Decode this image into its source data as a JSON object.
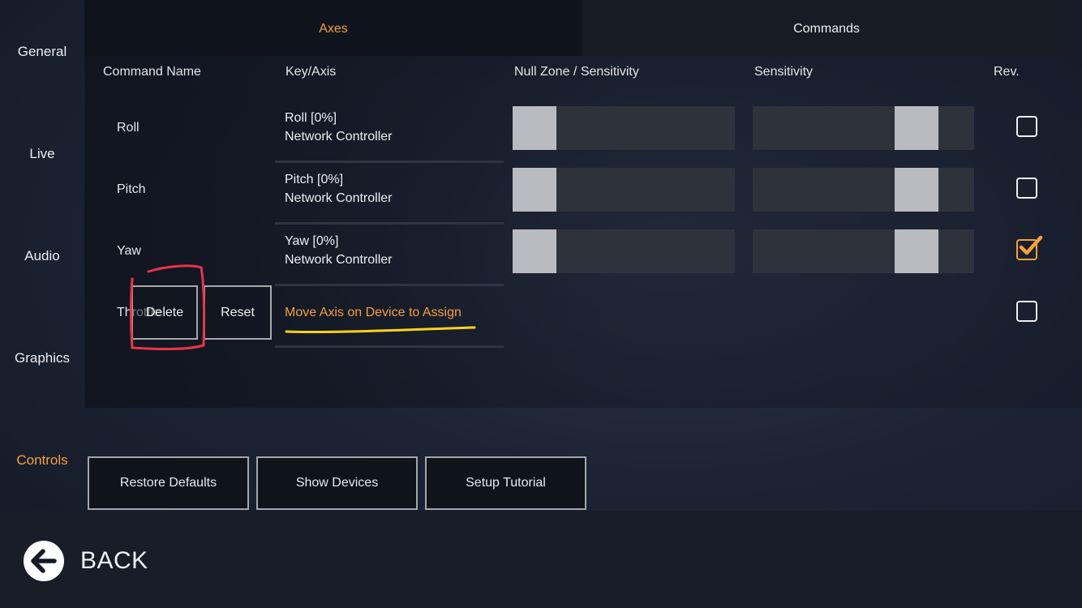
{
  "sidebar": {
    "items": [
      {
        "label": "General",
        "active": false
      },
      {
        "label": "Live",
        "active": false
      },
      {
        "label": "Audio",
        "active": false
      },
      {
        "label": "Graphics",
        "active": false
      },
      {
        "label": "Controls",
        "active": true
      }
    ]
  },
  "tabs": [
    {
      "label": "Axes",
      "active": true
    },
    {
      "label": "Commands",
      "active": false
    }
  ],
  "columns": [
    "Command Name",
    "Key/Axis",
    "Null Zone / Sensitivity",
    "Sensitivity",
    "Rev."
  ],
  "rows": [
    {
      "name": "Roll",
      "key_line1": "Roll [0%]",
      "key_line2": "Network Controller",
      "null_zone": 0.0,
      "sensitivity": 0.8,
      "reversed": false
    },
    {
      "name": "Pitch",
      "key_line1": "Pitch [0%]",
      "key_line2": "Network Controller",
      "null_zone": 0.0,
      "sensitivity": 0.8,
      "reversed": false
    },
    {
      "name": "Yaw",
      "key_line1": "Yaw [0%]",
      "key_line2": "Network Controller",
      "null_zone": 0.0,
      "sensitivity": 0.8,
      "reversed": true
    },
    {
      "name": "Throttle",
      "assign_prompt": "Move Axis on Device to Assign",
      "delete_label": "Delete",
      "reset_label": "Reset",
      "reversed": false
    }
  ],
  "buttons": {
    "restore_defaults": "Restore Defaults",
    "show_devices": "Show Devices",
    "setup_tutorial": "Setup Tutorial"
  },
  "back_label": "BACK",
  "colors": {
    "accent": "#f5a13a",
    "annotation_red": "#e8344a",
    "annotation_yellow": "#ffd21c"
  },
  "icons": [
    "back-arrow-icon",
    "checkmark-icon"
  ]
}
